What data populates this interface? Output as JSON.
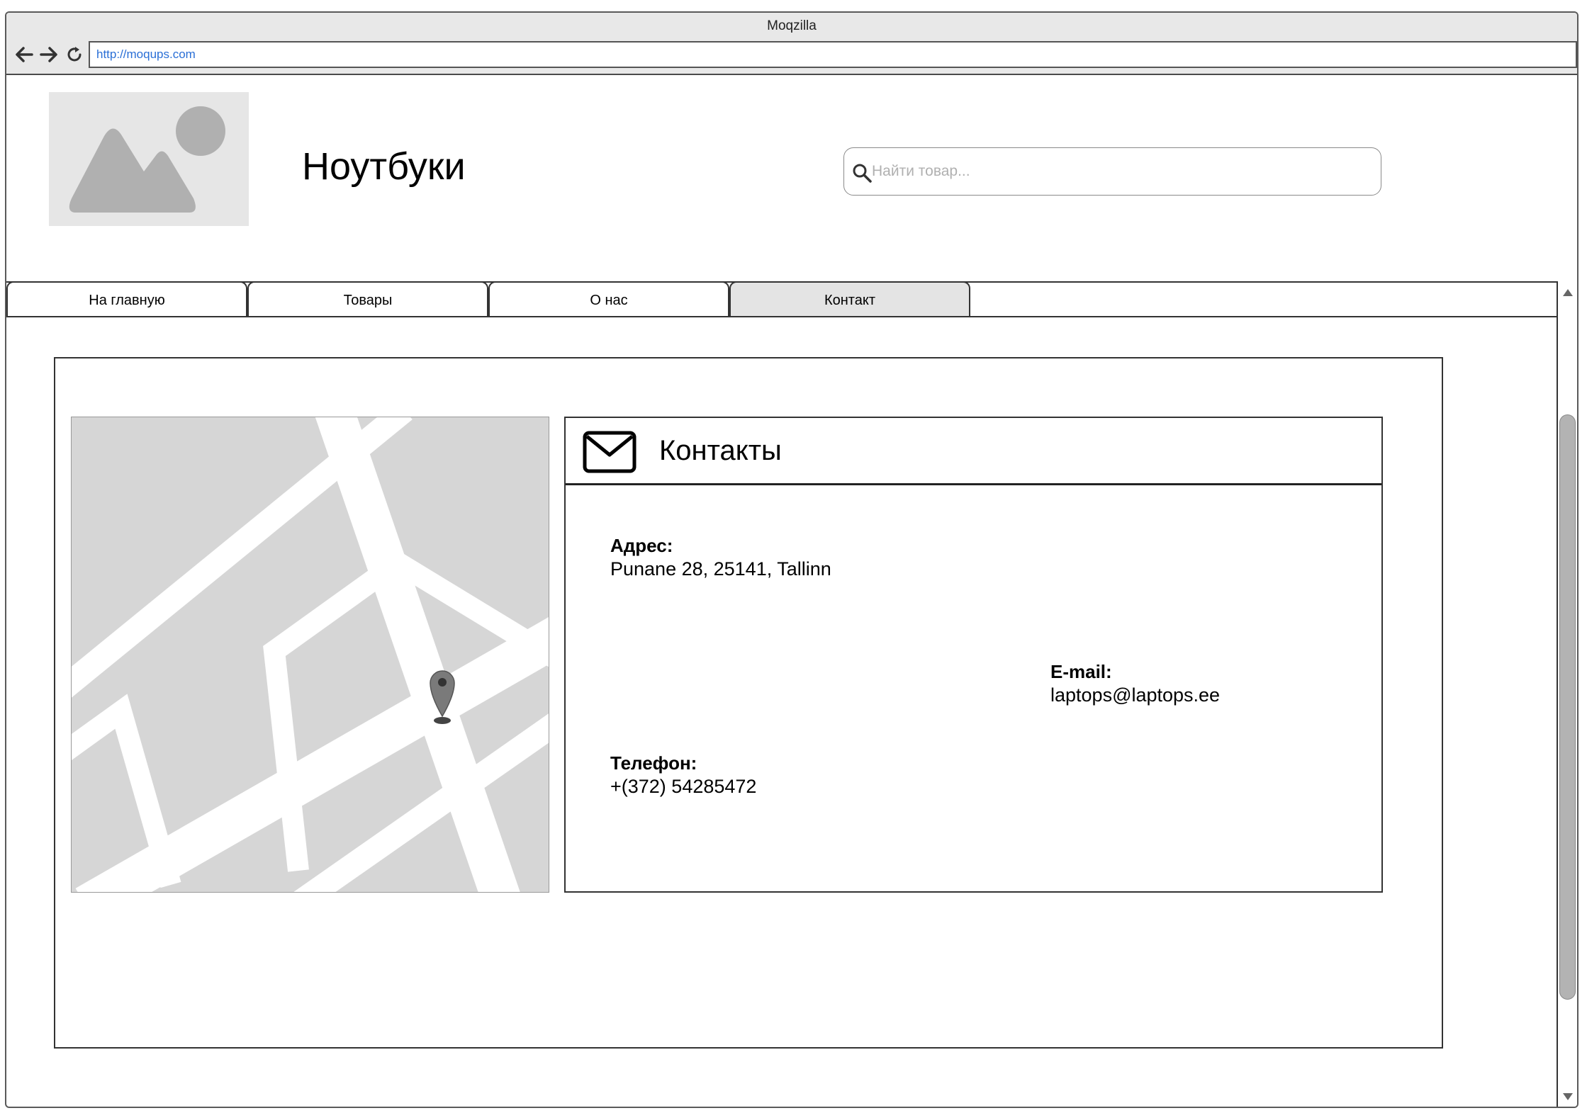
{
  "browser": {
    "window_title": "Moqzilla",
    "url": "http://moqups.com"
  },
  "header": {
    "site_title": "Ноутбуки",
    "search_placeholder": "Найти товар..."
  },
  "tabs": [
    {
      "label": "На главную",
      "active": false
    },
    {
      "label": "Товары",
      "active": false
    },
    {
      "label": "О нас",
      "active": false
    },
    {
      "label": "Контакт",
      "active": true
    }
  ],
  "contacts": {
    "title": "Контакты",
    "address_label": "Адрес:",
    "address_value": "Punane 28, 25141, Tallinn",
    "email_label": "E-mail:",
    "email_value": "laptops@laptops.ee",
    "phone_label": "Телефон:",
    "phone_value": "+(372) 54285472"
  },
  "icons": [
    "back-arrow-icon",
    "forward-arrow-icon",
    "reload-icon",
    "image-placeholder-icon",
    "search-icon",
    "mail-icon",
    "map-pin-icon",
    "scroll-up-icon",
    "scroll-down-icon"
  ]
}
